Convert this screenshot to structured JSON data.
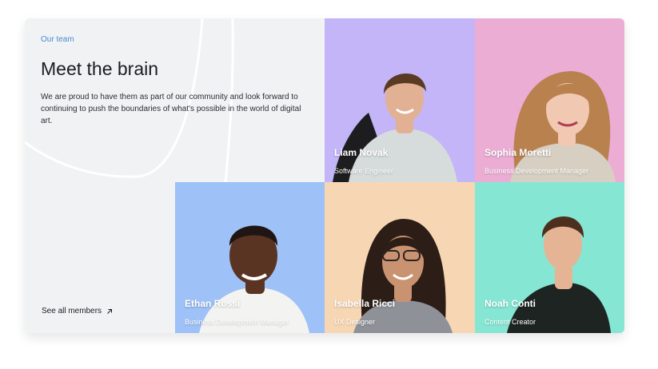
{
  "section": {
    "eyebrow": "Our team",
    "title": "Meet the brain",
    "description": "We are proud to have them as part of our community and look forward to continuing to push the boundaries of what's possible in the world of digital art.",
    "see_all_label": "See all members",
    "see_all_icon": "arrow-up-right-icon"
  },
  "members": [
    {
      "name": "Liam Novak",
      "role": "Software Engineer",
      "bg": "#c3b5f8",
      "skin": "#e2b092",
      "hair": "#5a3a22",
      "shirt": "#d6dcdb"
    },
    {
      "name": "Sophia Moretti",
      "role": "Business Development Manager",
      "bg": "#ebadd4",
      "skin": "#f1c8b2",
      "hair": "#b8814e",
      "shirt": "#d7cfc2"
    },
    {
      "name": "Ethan Rossi",
      "role": "Business Development Manager",
      "bg": "#9ec1f7",
      "skin": "#5a3422",
      "hair": "#1f1512",
      "shirt": "#f3f3f1"
    },
    {
      "name": "Isabella Ricci",
      "role": "UX Designer",
      "bg": "#f7d7b3",
      "skin": "#c99271",
      "hair": "#2c1d16",
      "shirt": "#8e9298"
    },
    {
      "name": "Noah Conti",
      "role": "Content Creator",
      "bg": "#86e6d4",
      "skin": "#e5b494",
      "hair": "#4d2f1e",
      "shirt": "#1d2421"
    }
  ],
  "colors": {
    "card_bg": "#f1f2f4",
    "accent": "#4a8ad4",
    "text": "#1c1d22"
  }
}
